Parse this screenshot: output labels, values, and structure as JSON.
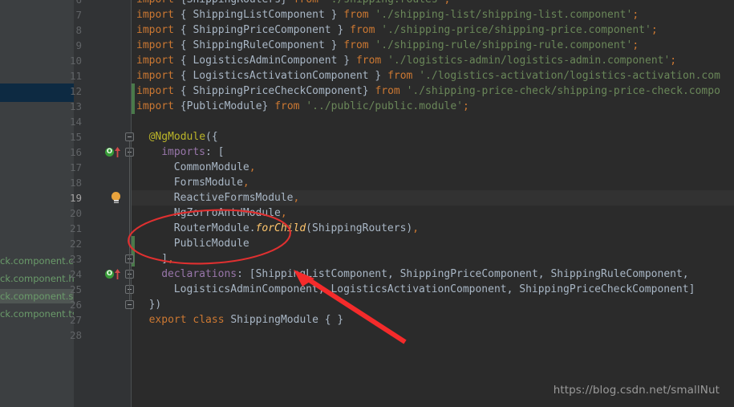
{
  "window": {
    "theme": "darcula",
    "editor_background": "#2b2b2b",
    "gutter_background": "#313335",
    "panel_background": "#3c3f41",
    "selection_band_color": "#0d2a42"
  },
  "left_panel": {
    "files": [
      {
        "label": "ck.component.css",
        "selected": false
      },
      {
        "label": "ck.component.htm",
        "selected": false
      },
      {
        "label": "ck.component.spe",
        "selected": true
      },
      {
        "label": "ck.component.ts",
        "selected": false
      }
    ]
  },
  "editor": {
    "first_line_number": 6,
    "current_line_number": 19,
    "lines": [
      {
        "n": 6,
        "tokens": [
          {
            "t": "import ",
            "c": "k"
          },
          {
            "t": "{ShippingRouters} ",
            "c": "def"
          },
          {
            "t": "from ",
            "c": "k"
          },
          {
            "t": "'./shipping.routes'",
            "c": "str"
          },
          {
            "t": ";",
            "c": "semi"
          }
        ]
      },
      {
        "n": 7,
        "tokens": [
          {
            "t": "import ",
            "c": "k"
          },
          {
            "t": "{ ShippingListComponent } ",
            "c": "def"
          },
          {
            "t": "from ",
            "c": "k"
          },
          {
            "t": "'./shipping-list/shipping-list.component'",
            "c": "str"
          },
          {
            "t": ";",
            "c": "semi"
          }
        ]
      },
      {
        "n": 8,
        "tokens": [
          {
            "t": "import ",
            "c": "k"
          },
          {
            "t": "{ ShippingPriceComponent } ",
            "c": "def"
          },
          {
            "t": "from ",
            "c": "k"
          },
          {
            "t": "'./shipping-price/shipping-price.component'",
            "c": "str"
          },
          {
            "t": ";",
            "c": "semi"
          }
        ]
      },
      {
        "n": 9,
        "tokens": [
          {
            "t": "import ",
            "c": "k"
          },
          {
            "t": "{ ShippingRuleComponent } ",
            "c": "def"
          },
          {
            "t": "from ",
            "c": "k"
          },
          {
            "t": "'./shipping-rule/shipping-rule.component'",
            "c": "str"
          },
          {
            "t": ";",
            "c": "semi"
          }
        ]
      },
      {
        "n": 10,
        "tokens": [
          {
            "t": "import ",
            "c": "k"
          },
          {
            "t": "{ LogisticsAdminComponent } ",
            "c": "def"
          },
          {
            "t": "from ",
            "c": "k"
          },
          {
            "t": "'./logistics-admin/logistics-admin.component'",
            "c": "str"
          },
          {
            "t": ";",
            "c": "semi"
          }
        ]
      },
      {
        "n": 11,
        "tokens": [
          {
            "t": "import ",
            "c": "k"
          },
          {
            "t": "{ LogisticsActivationComponent } ",
            "c": "def"
          },
          {
            "t": "from ",
            "c": "k"
          },
          {
            "t": "'./logistics-activation/logistics-activation.com",
            "c": "str"
          }
        ]
      },
      {
        "n": 12,
        "tokens": [
          {
            "t": "import ",
            "c": "k"
          },
          {
            "t": "{ ShippingPriceCheckComponent} ",
            "c": "def"
          },
          {
            "t": "from ",
            "c": "k"
          },
          {
            "t": "'./shipping-price-check/shipping-price-check.compo",
            "c": "str"
          }
        ]
      },
      {
        "n": 13,
        "tokens": [
          {
            "t": "import ",
            "c": "k"
          },
          {
            "t": "{PublicModule} ",
            "c": "def"
          },
          {
            "t": "from ",
            "c": "k"
          },
          {
            "t": "'../public/public.module'",
            "c": "str"
          },
          {
            "t": ";",
            "c": "semi"
          }
        ]
      },
      {
        "n": 14,
        "tokens": []
      },
      {
        "n": 15,
        "indent": 1,
        "tokens": [
          {
            "t": "@NgModule",
            "c": "anno"
          },
          {
            "t": "({",
            "c": "punc"
          }
        ]
      },
      {
        "n": 16,
        "indent": 2,
        "tokens": [
          {
            "t": "imports",
            "c": "prop"
          },
          {
            "t": ": [",
            "c": "punc"
          }
        ]
      },
      {
        "n": 17,
        "indent": 3,
        "tokens": [
          {
            "t": "CommonModule",
            "c": "def"
          },
          {
            "t": ",",
            "c": "comma"
          }
        ]
      },
      {
        "n": 18,
        "indent": 3,
        "tokens": [
          {
            "t": "FormsModule",
            "c": "def"
          },
          {
            "t": ",",
            "c": "comma"
          }
        ]
      },
      {
        "n": 19,
        "indent": 3,
        "tokens": [
          {
            "t": "ReactiveFormsModule",
            "c": "def"
          },
          {
            "t": ",",
            "c": "comma"
          }
        ]
      },
      {
        "n": 20,
        "indent": 3,
        "tokens": [
          {
            "t": "NgZorroAntdModule",
            "c": "def"
          },
          {
            "t": ",",
            "c": "comma"
          }
        ]
      },
      {
        "n": 21,
        "indent": 3,
        "tokens": [
          {
            "t": "RouterModule.",
            "c": "def"
          },
          {
            "t": "forChild",
            "c": "fn"
          },
          {
            "t": "(ShippingRouters)",
            "c": "def"
          },
          {
            "t": ",",
            "c": "comma"
          }
        ]
      },
      {
        "n": 22,
        "indent": 3,
        "tokens": [
          {
            "t": "PublicModule",
            "c": "def"
          }
        ]
      },
      {
        "n": 23,
        "indent": 2,
        "tokens": [
          {
            "t": "]",
            "c": "punc"
          },
          {
            "t": ",",
            "c": "comma"
          }
        ]
      },
      {
        "n": 24,
        "indent": 2,
        "tokens": [
          {
            "t": "declarations",
            "c": "prop"
          },
          {
            "t": ": [ShippingListComponent, ShippingPriceComponent, ShippingRuleComponent,",
            "c": "def"
          }
        ]
      },
      {
        "n": 25,
        "indent": 3,
        "tokens": [
          {
            "t": "LogisticsAdminComponent, LogisticsActivationComponent, ShippingPriceCheckComponent]",
            "c": "def"
          }
        ]
      },
      {
        "n": 26,
        "indent": 1,
        "tokens": [
          {
            "t": "})",
            "c": "punc"
          }
        ]
      },
      {
        "n": 27,
        "indent": 1,
        "tokens": [
          {
            "t": "export ",
            "c": "k"
          },
          {
            "t": "class ",
            "c": "k"
          },
          {
            "t": "ShippingModule ",
            "c": "def"
          },
          {
            "t": "{ }",
            "c": "punc"
          }
        ]
      },
      {
        "n": 28,
        "tokens": []
      }
    ]
  },
  "gutter_markers": {
    "implementation_markers": [
      {
        "line": 16,
        "glyph": "O",
        "color": "#389c38"
      },
      {
        "line": 24,
        "glyph": "O",
        "color": "#389c38"
      }
    ],
    "intention_bulb": {
      "line": 19,
      "color": "#e8a33d"
    },
    "vcs_change_bars": [
      {
        "line": 12,
        "color": "#4a7a4a"
      },
      {
        "line": 13,
        "color": "#4a7a4a"
      },
      {
        "line": 22,
        "color": "#4a7a4a"
      },
      {
        "line": 23,
        "color": "#4a7a4a"
      }
    ],
    "fold_markers": [
      15,
      16,
      23,
      24,
      25,
      26
    ]
  },
  "annotations": {
    "ellipse": {
      "shape": "ellipse",
      "color": "#e03030",
      "encircles": "imports array entries NgZorroAntdModule / RouterModule.forChild(ShippingRouters) / PublicModule"
    },
    "arrow": {
      "shape": "arrow",
      "color": "#f42b2b",
      "points_to": "declarations: [ShippingListComponent"
    }
  },
  "watermark": {
    "text": "https://blog.csdn.net/smallNut"
  }
}
